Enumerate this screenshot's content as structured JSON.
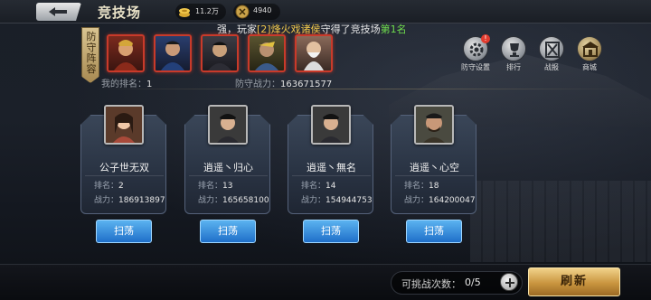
{
  "header": {
    "title": "竞技场",
    "resources": [
      {
        "icon": "gold-coin-icon",
        "value": "11.2万"
      },
      {
        "icon": "arena-token-icon",
        "value": "4940"
      }
    ]
  },
  "marquee": {
    "prefix": "强，玩家",
    "player": "[2]烽火戏诸侯",
    "middle": "守得了竞技场",
    "place": "第1名"
  },
  "defense": {
    "tag": "防守阵容",
    "heroes": [
      "hero-portrait-icon",
      "hero-portrait-icon",
      "hero-portrait-icon",
      "hero-portrait-icon",
      "hero-portrait-icon"
    ],
    "my_rank_label": "我的排名：",
    "my_rank_value": "1",
    "power_label": "防守战力：",
    "power_value": "163671577"
  },
  "actions": [
    {
      "label": "防守设置",
      "icon": "gear-icon",
      "badge": "!"
    },
    {
      "label": "排行",
      "icon": "trophy-icon"
    },
    {
      "label": "战报",
      "icon": "crossed-swords-icon"
    },
    {
      "label": "商城",
      "icon": "shop-icon"
    }
  ],
  "opponents": [
    {
      "name": "公子世无双",
      "rank_label": "排名：",
      "rank": "2",
      "power_label": "战力：",
      "power": "186913897",
      "button": "扫荡"
    },
    {
      "name": "逍遥丶归心",
      "rank_label": "排名：",
      "rank": "13",
      "power_label": "战力：",
      "power": "165658100",
      "button": "扫荡"
    },
    {
      "name": "逍遥丶無名",
      "rank_label": "排名：",
      "rank": "14",
      "power_label": "战力：",
      "power": "154944753",
      "button": "扫荡"
    },
    {
      "name": "逍遥丶心空",
      "rank_label": "排名：",
      "rank": "18",
      "power_label": "战力：",
      "power": "164200047",
      "button": "扫荡"
    }
  ],
  "footer": {
    "challenge_label": "可挑战次数：",
    "challenge_count": "0/5",
    "refresh": "刷新"
  },
  "colors": {
    "accent_gold": "#f2c94c",
    "highlight_green": "#6fdc4d",
    "button_blue": "#1f6fc9",
    "hero_border_red": "#c93a2a"
  }
}
